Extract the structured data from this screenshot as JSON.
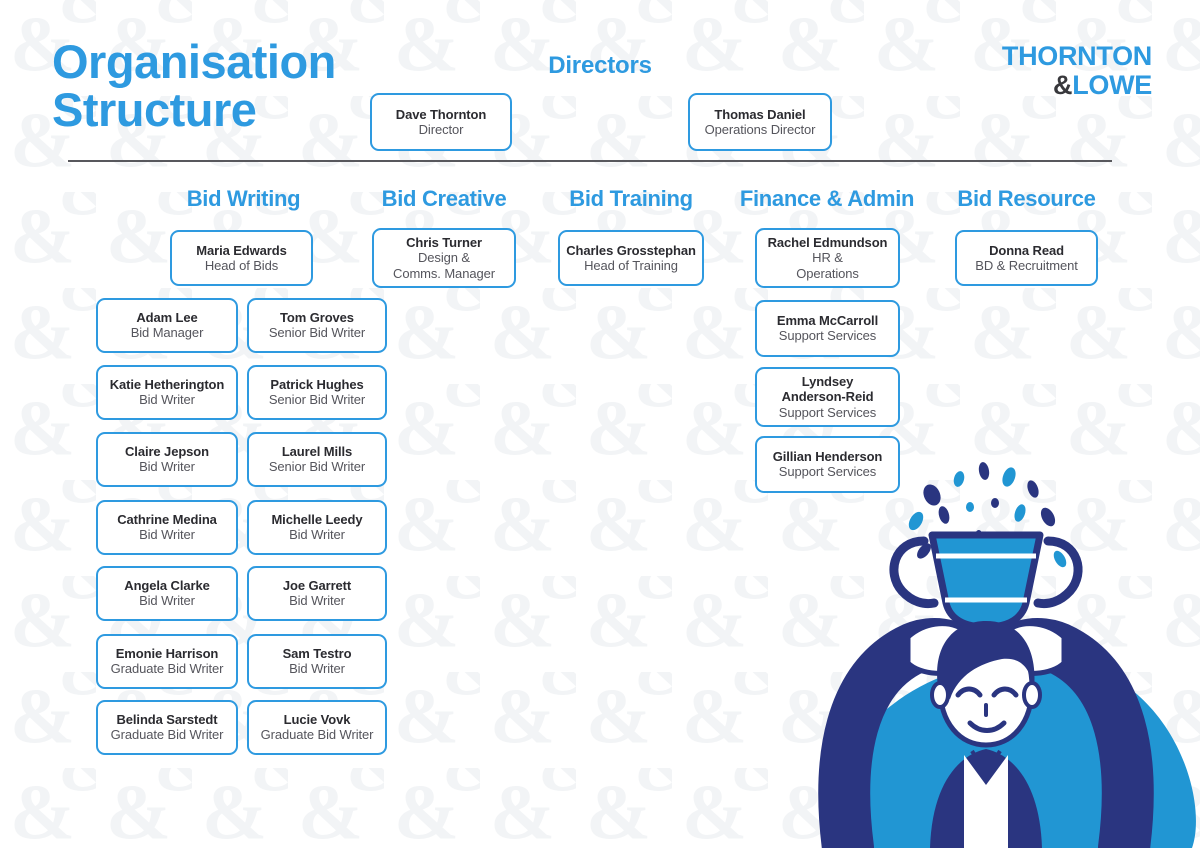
{
  "header": {
    "title_line1": "Organisation",
    "title_line2": "Structure",
    "directors_heading": "Directors",
    "brand_line1": "THORNTON",
    "brand_amp": "&",
    "brand_line2": "LOWE"
  },
  "colors": {
    "accent_blue": "#2e9ae0",
    "illustration_blue": "#2196d3",
    "illustration_navy": "#2a3580",
    "text_dark": "#2b2b30",
    "text_grey": "#55555c",
    "divider": "#58585d"
  },
  "directors": [
    {
      "name": "Dave Thornton",
      "role": "Director"
    },
    {
      "name": "Thomas Daniel",
      "role": "Operations Director"
    }
  ],
  "departments": [
    {
      "heading": "Bid Writing",
      "lead": {
        "name": "Maria Edwards",
        "role": "Head of Bids"
      },
      "left_column": [
        {
          "name": "Adam Lee",
          "role": "Bid Manager"
        },
        {
          "name": "Katie Hetherington",
          "role": "Bid Writer"
        },
        {
          "name": "Claire Jepson",
          "role": "Bid Writer"
        },
        {
          "name": "Cathrine Medina",
          "role": "Bid Writer"
        },
        {
          "name": "Angela Clarke",
          "role": "Bid Writer"
        },
        {
          "name": "Emonie Harrison",
          "role": "Graduate Bid Writer"
        },
        {
          "name": "Belinda Sarstedt",
          "role": "Graduate Bid Writer"
        }
      ],
      "right_column": [
        {
          "name": "Tom Groves",
          "role": "Senior Bid Writer"
        },
        {
          "name": "Patrick Hughes",
          "role": "Senior Bid Writer"
        },
        {
          "name": "Laurel Mills",
          "role": "Senior Bid Writer"
        },
        {
          "name": "Michelle Leedy",
          "role": "Bid Writer"
        },
        {
          "name": "Joe Garrett",
          "role": "Bid Writer"
        },
        {
          "name": "Sam Testro",
          "role": "Bid Writer"
        },
        {
          "name": "Lucie Vovk",
          "role": "Graduate Bid Writer"
        }
      ]
    },
    {
      "heading": "Bid Creative",
      "lead": {
        "name": "Chris Turner",
        "role": "Design &\nComms. Manager"
      },
      "members": []
    },
    {
      "heading": "Bid Training",
      "lead": {
        "name": "Charles Grosstephan",
        "role": "Head of Training"
      },
      "members": []
    },
    {
      "heading": "Finance & Admin",
      "lead": {
        "name": "Rachel Edmundson",
        "role": "HR &\nOperations"
      },
      "members": [
        {
          "name": "Emma McCarroll",
          "role": "Support Services"
        },
        {
          "name": "Lyndsey\nAnderson-Reid",
          "role": "Support Services"
        },
        {
          "name": "Gillian Henderson",
          "role": "Support Services"
        }
      ]
    },
    {
      "heading": "Bid Resource",
      "lead": {
        "name": "Donna Read",
        "role": "BD & Recruitment"
      },
      "members": []
    }
  ],
  "illustration": {
    "name": "person-holding-trophy-illustration",
    "elements": [
      "confetti",
      "trophy-cup",
      "raised-hands",
      "smiling-person",
      "blue-blob-background"
    ]
  },
  "watermark": {
    "glyph": "&"
  }
}
